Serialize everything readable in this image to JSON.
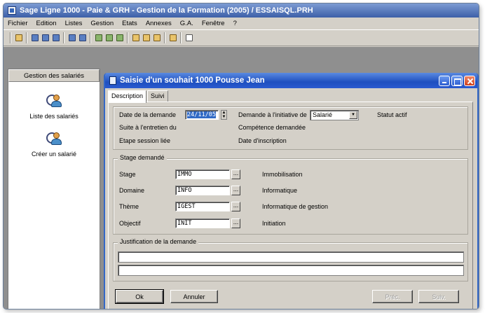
{
  "app": {
    "title": "Sage Ligne 1000 - Paie & GRH - Gestion de la Formation (2005)  / ESSAISQL.PRH"
  },
  "menu": [
    "Fichier",
    "Edition",
    "Listes",
    "Gestion",
    "Etats",
    "Annexes",
    "G.A.",
    "Fenêtre",
    "?"
  ],
  "toolbar": {
    "icons": [
      "folder-icon",
      "people-icon",
      "people-icon",
      "people-table-icon",
      "people-icon",
      "people-icon",
      "people-table-icon",
      "people-table-icon",
      "people-table-icon",
      "folder-people-icon",
      "folder-people-icon",
      "folder-people-icon",
      "copy-icon",
      "notepad-icon"
    ]
  },
  "sidebar": {
    "header": "Gestion des salariés",
    "items": [
      {
        "label": "Liste des salariés",
        "icon": "employee-list-icon"
      },
      {
        "label": "Créer un salarié",
        "icon": "create-employee-icon"
      }
    ]
  },
  "dialog": {
    "title": "Saisie d'un souhait 1000  Pousse  Jean",
    "tabs": [
      "Description",
      "Suivi"
    ],
    "top": {
      "date_label": "Date de la demande",
      "date_value": "24/11/05",
      "initiative_label": "Demande à l'initiative de",
      "initiative_value": "Salarié",
      "status_label": "Statut actif",
      "suite_label": "Suite à l'entretien du",
      "competence_label": "Compétence demandée",
      "etape_label": "Etape session liée",
      "inscription_label": "Date d'inscription"
    },
    "stage_group": {
      "legend": "Stage demandé",
      "rows": [
        {
          "label": "Stage",
          "code": "IMMO",
          "description": "Immobilisation"
        },
        {
          "label": "Domaine",
          "code": "INFO",
          "description": "Informatique"
        },
        {
          "label": "Thème",
          "code": "IGEST",
          "description": "Informatique de gestion"
        },
        {
          "label": "Objectif",
          "code": "INIT",
          "description": "Initiation"
        }
      ],
      "browse_label": "..."
    },
    "justification": {
      "legend": "Justification de la demande"
    },
    "buttons": {
      "ok": "Ok",
      "cancel": "Annuler",
      "prev": "Préc.",
      "next": "Suiv."
    }
  }
}
